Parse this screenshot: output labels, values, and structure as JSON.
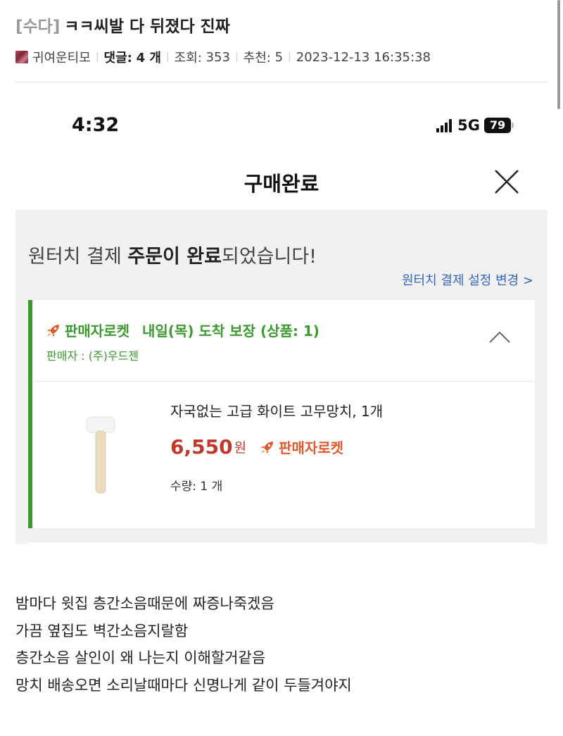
{
  "post": {
    "category": "[수다]",
    "title": "ㅋㅋ씨발 다 뒤졌다 진짜",
    "author": "귀여운티모",
    "comments_label": "댓글:",
    "comments_value": "4 개",
    "views_label": "조회:",
    "views_value": "353",
    "likes_label": "추천:",
    "likes_value": "5",
    "datetime": "2023-12-13 16:35:38"
  },
  "phone": {
    "status": {
      "time": "4:32",
      "network": "5G",
      "battery": "79"
    },
    "screen_title": "구매완료",
    "complete_msg": {
      "prefix": "원터치 결제 ",
      "bold": "주문이 완료",
      "suffix": "되었습니다!"
    },
    "settings_link": "원터치 결제 설정 변경 >",
    "order": {
      "tag": "판매자로켓",
      "delivery": "내일(목) 도착 보장 (상품: 1)",
      "seller": "판매자 : (주)우드젠",
      "product_name": "자국없는 고급 화이트 고무망치, 1개",
      "price": "6,550",
      "currency": "원",
      "badge": "판매자로켓",
      "quantity": "수량: 1 개"
    }
  },
  "body_lines": [
    "밤마다 윗집 층간소음때문에 짜증나죽겠음",
    "가끔 옆집도 벽간소음지랄함",
    "층간소음 살인이 왜 나는지 이해할거같음",
    "망치 배송오면 소리날때마다 신명나게 같이 두들겨야지"
  ],
  "colors": {
    "rocket_green": "#3a9a2e",
    "price_red": "#c0392b",
    "link_blue": "#3266c4",
    "badge_orange": "#e2582a"
  }
}
